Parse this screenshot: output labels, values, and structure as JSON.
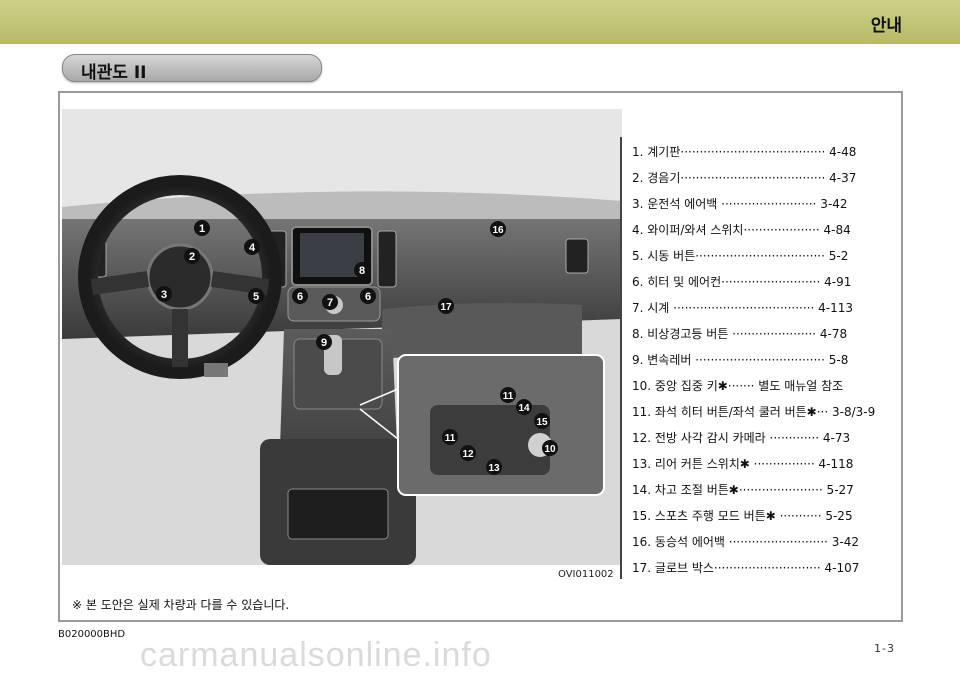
{
  "header": {
    "section_title": "안내"
  },
  "section_tab": {
    "label": "내관도 II"
  },
  "figure": {
    "image_code": "OVI011002",
    "callouts": [
      "1",
      "2",
      "3",
      "4",
      "5",
      "6",
      "7",
      "6",
      "8",
      "9",
      "16",
      "17",
      "11",
      "14",
      "15",
      "11",
      "12",
      "13",
      "10"
    ]
  },
  "legend": {
    "items": [
      "1.  계기판······································ 4-48",
      "2.  경음기······································ 4-37",
      "3.  운전석 에어백 ························· 3-42",
      "4.  와이퍼/와셔 스위치···················· 4-84",
      "5.  시동 버튼·································· 5-2",
      "6.  히터 및 에어컨·························· 4-91",
      "7.  시계 ····································· 4-113",
      "8.  비상경고등 버튼 ······················ 4-78",
      "9.  변속레버 ·································· 5-8",
      "10. 중앙 집중 키✱······· 별도 매뉴얼 참조",
      "11. 좌석 히터 버튼/좌석 쿨러 버튼✱··· 3-8/3-9",
      "12. 전방 사각 감시 카메라 ············· 4-73",
      "13. 리어 커튼 스위치✱  ················ 4-118",
      "14. 차고 조절 버튼✱······················ 5-27",
      "15. 스포츠 주행 모드 버튼✱ ··········· 5-25",
      "16. 동승석 에어백 ·························· 3-42",
      "17. 글로브 박스···························· 4-107"
    ]
  },
  "note": "※  본 도안은 실제 차량과 다를 수 있습니다.",
  "footer": {
    "doc_code": "B020000BHD",
    "page_number": "1-3",
    "watermark": "carmanualsonline.info"
  }
}
